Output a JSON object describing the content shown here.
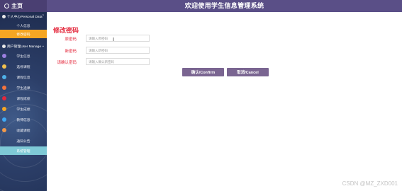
{
  "header": {
    "home_label": "主页",
    "app_title": "欢迎使用学生信息管理系统"
  },
  "sidebar": {
    "groups": [
      {
        "label": "个人中心Personal Data",
        "children": [
          {
            "label": "个人信息"
          },
          {
            "label": "修改密码",
            "state": "active"
          }
        ]
      },
      {
        "label": "用户管理User Manage",
        "children": [
          {
            "label": "学生信息"
          },
          {
            "label": "选修课程"
          },
          {
            "label": "课程信息"
          },
          {
            "label": "学生选课"
          },
          {
            "label": "课程成绩"
          },
          {
            "label": "学生成绩"
          },
          {
            "label": "教师信息"
          },
          {
            "label": "收藏课程"
          },
          {
            "label": "通知公告"
          },
          {
            "label": "系统管理",
            "state": "current"
          }
        ]
      }
    ],
    "dot_colors": [
      "#9b7fe0",
      "#f2c14e",
      "#4fb0e8",
      "#f5743d",
      "#e4283c",
      "#f5a623",
      "#3fa9f5",
      "#f2994a"
    ]
  },
  "form": {
    "title": "修改密码",
    "fields": [
      {
        "label": "原密码",
        "placeholder": "请输入原密码"
      },
      {
        "label": "新密码",
        "placeholder": "请输入新密码"
      },
      {
        "label": "请确认密码",
        "placeholder": "请输入确认新密码"
      }
    ],
    "confirm_label": "确认/Confirm",
    "cancel_label": "取消/Cancel"
  },
  "watermark": "CSDN @MZ_ZXD001",
  "colors": {
    "header": "#5a4f87",
    "accent_red": "#e4283c",
    "active_orange": "#f5a623",
    "current_teal": "#7ec9d6",
    "button": "#7a6591"
  }
}
